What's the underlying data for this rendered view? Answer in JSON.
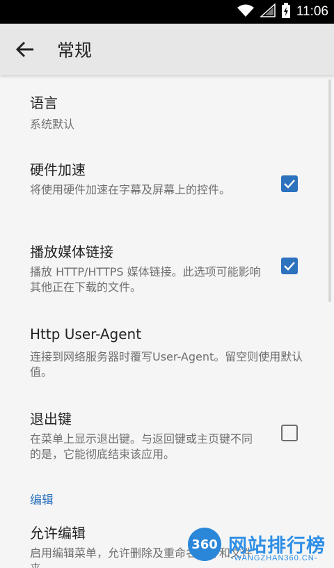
{
  "status_bar": {
    "time": "11:06",
    "wifi_icon": "wifi-icon",
    "signal_icon": "signal-icon",
    "battery_icon": "battery-charging-icon"
  },
  "app_bar": {
    "back_icon": "arrow-back-icon",
    "title": "常规"
  },
  "settings": [
    {
      "title": "语言",
      "subtitle": "系统默认",
      "checkbox": null
    },
    {
      "title": "硬件加速",
      "subtitle": "将使用硬件加速在字幕及屏幕上的控件。",
      "checkbox": true
    },
    {
      "title": "播放媒体链接",
      "subtitle": "播放 HTTP/HTTPS 媒体链接。此选项可能影响其他正在下载的文件。",
      "checkbox": true
    },
    {
      "title": "Http User-Agent",
      "subtitle": "连接到网络服务器时覆写User-Agent。留空则使用默认值。",
      "checkbox": null
    },
    {
      "title": "退出键",
      "subtitle": "在菜单上显示退出键。与返回键或主页键不同的是，它能彻底结束该应用。",
      "checkbox": false
    }
  ],
  "section_edit": {
    "header": "编辑"
  },
  "edit_item": {
    "title": "允许编辑",
    "subtitle": "启用编辑菜单，允许删除及重命名文件和文件夹。"
  },
  "watermark": {
    "circle": "360",
    "title": "网站排行榜",
    "url": "-WANGZHAN360.CN-"
  },
  "colors": {
    "accent": "#2d72bd",
    "app_bar": "#e7e7e7",
    "background": "#f5f5f5",
    "status_bar": "#000000"
  }
}
